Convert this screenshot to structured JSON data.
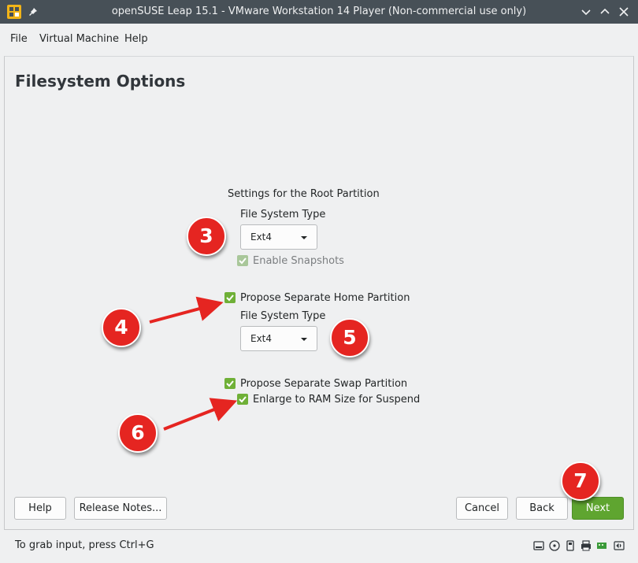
{
  "window": {
    "title": "openSUSE Leap 15.1 - VMware Workstation 14 Player (Non-commercial use only)"
  },
  "menu": {
    "items": [
      "File",
      "Virtual Machine",
      "Help"
    ]
  },
  "page": {
    "title": "Filesystem Options",
    "root_section_label": "Settings for the Root Partition",
    "root_fs_type_label": "File System Type",
    "root_fs_value": "Ext4",
    "enable_snapshots_label": "Enable Snapshots",
    "propose_home_label": "Propose Separate Home Partition",
    "home_fs_type_label": "File System Type",
    "home_fs_value": "Ext4",
    "propose_swap_label": "Propose Separate Swap Partition",
    "enlarge_swap_label": "Enlarge to RAM Size for Suspend"
  },
  "checkboxes": {
    "enable_snapshots": true,
    "propose_home": true,
    "propose_swap": true,
    "enlarge_swap": true
  },
  "annotations": {
    "step3": "3",
    "step4": "4",
    "step5": "5",
    "step6": "6",
    "step7": "7"
  },
  "buttons": {
    "help": "Help",
    "release_notes": "Release Notes...",
    "cancel": "Cancel",
    "back": "Back",
    "next": "Next"
  },
  "statusbar": {
    "hint": "To grab input, press Ctrl+G"
  },
  "colors": {
    "accent_green": "#5fa530",
    "annotation_red": "#e52521",
    "titlebar": "#475057"
  },
  "icons": [
    "vmware-logo-icon",
    "pin-icon",
    "chevron-down-icon",
    "chevron-up-icon",
    "close-icon",
    "hard-disk-icon",
    "cd-dvd-icon",
    "usb-icon",
    "printer-icon",
    "network-adapter-icon",
    "sound-icon"
  ]
}
